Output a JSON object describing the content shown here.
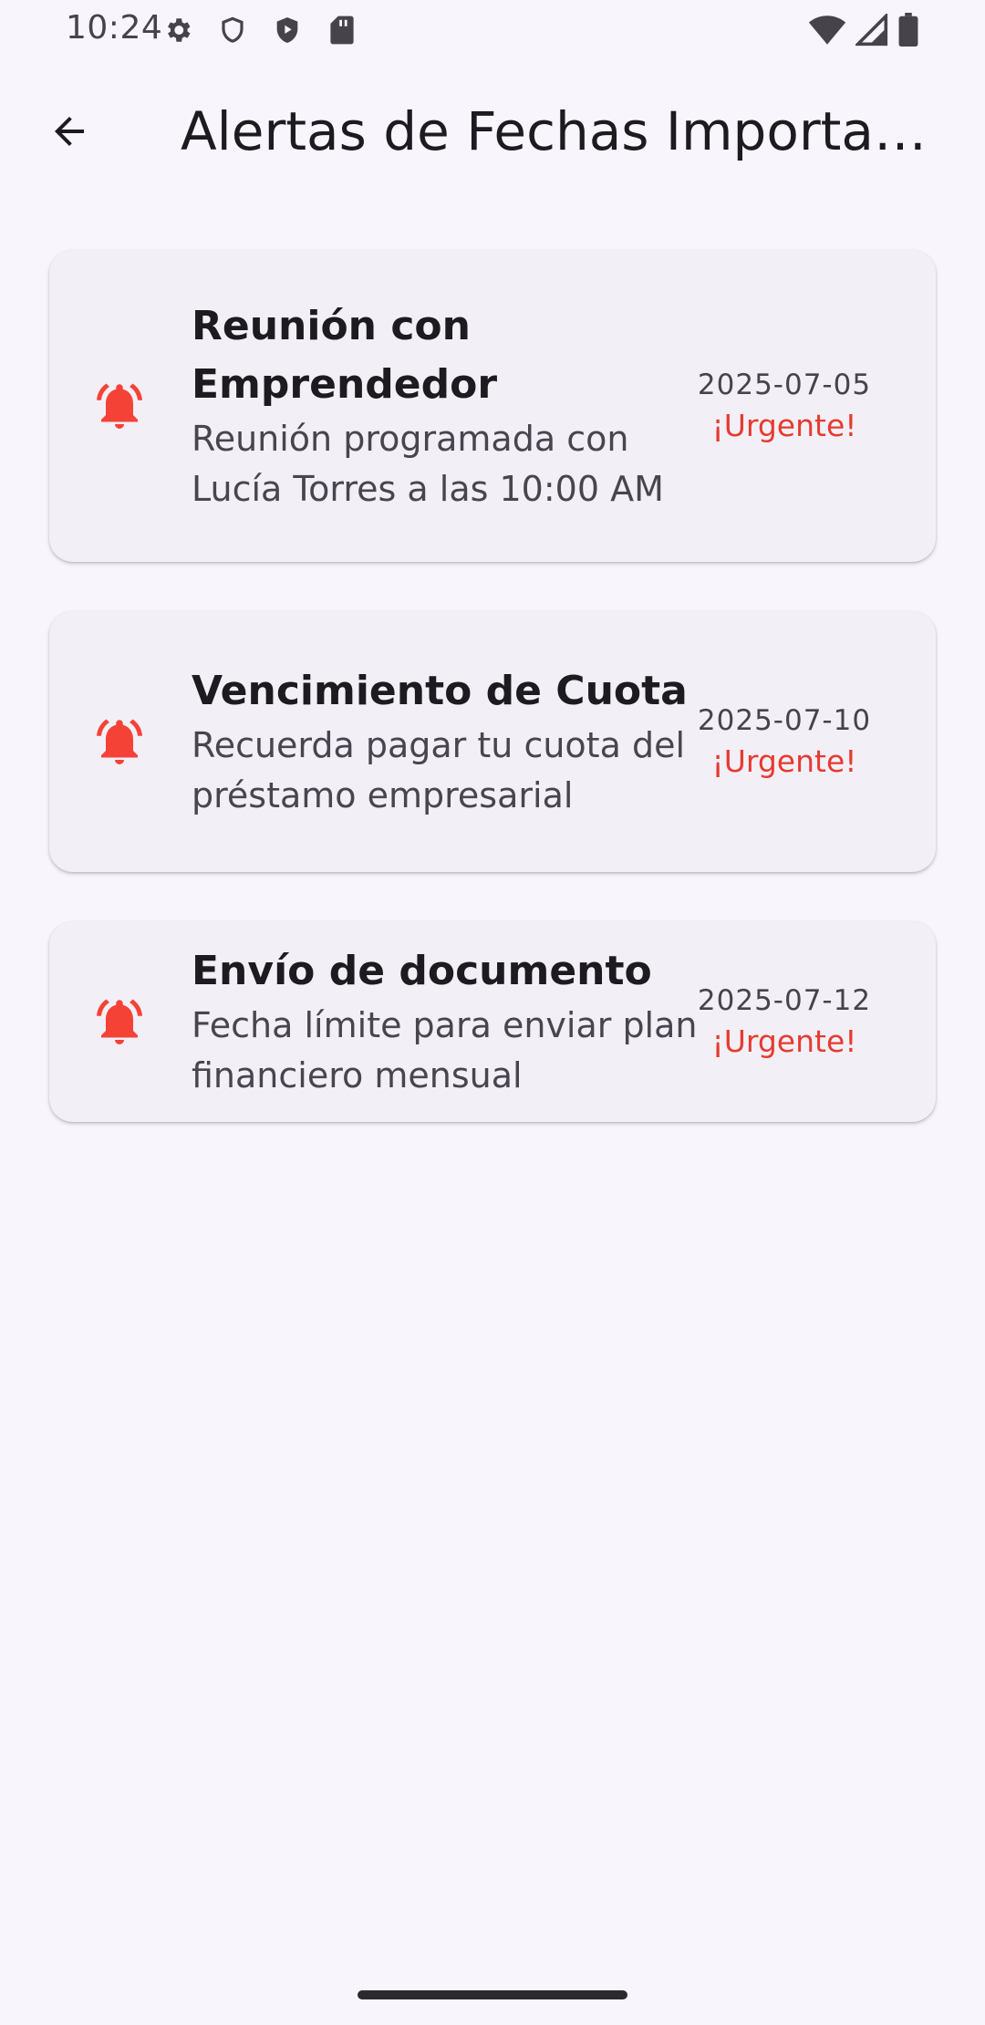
{
  "status_bar": {
    "time": "10:24",
    "left_icons": [
      "gear-icon",
      "shield-icon",
      "play-protect-icon",
      "sd-card-icon"
    ],
    "right_icons": [
      "wifi-icon",
      "signal-icon",
      "battery-icon"
    ]
  },
  "app_bar": {
    "title": "Alertas de Fechas Importantes",
    "back_icon": "arrow-back-icon"
  },
  "alerts": [
    {
      "title": "Reunión con Emprendedor",
      "description": "Reunión programada con Lucía Torres a las 10:00 AM",
      "date": "2025-07-05",
      "status": "¡Urgente!",
      "icon": "alarm-bell-icon"
    },
    {
      "title": "Vencimiento de Cuota",
      "description": "Recuerda pagar tu cuota del préstamo empresarial",
      "date": "2025-07-10",
      "status": "¡Urgente!",
      "icon": "alarm-bell-icon"
    },
    {
      "title": "Envío de documento",
      "description": "Fecha límite para enviar plan financiero mensual",
      "date": "2025-07-12",
      "status": "¡Urgente!",
      "icon": "alarm-bell-icon"
    }
  ],
  "colors": {
    "background": "#f8f5fc",
    "card": "#f3eff7",
    "urgent": "#e63b30",
    "bell": "#f44336"
  }
}
